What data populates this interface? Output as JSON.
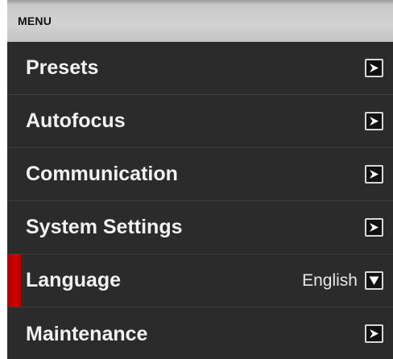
{
  "menu": {
    "title": "MENU",
    "items": [
      {
        "label": "Presets",
        "control": "chevron-right-icon"
      },
      {
        "label": "Autofocus",
        "control": "chevron-right-icon"
      },
      {
        "label": "Communication",
        "control": "chevron-right-icon"
      },
      {
        "label": "System Settings",
        "control": "chevron-right-icon"
      },
      {
        "label": "Language",
        "value": "English",
        "control": "chevron-down-icon",
        "active": true
      },
      {
        "label": "Maintenance",
        "control": "chevron-right-icon"
      }
    ]
  },
  "colors": {
    "background": "#2b2b2b",
    "header": "#c9c9c9",
    "accent": "#cc0000",
    "text": "#f2f2f2"
  }
}
